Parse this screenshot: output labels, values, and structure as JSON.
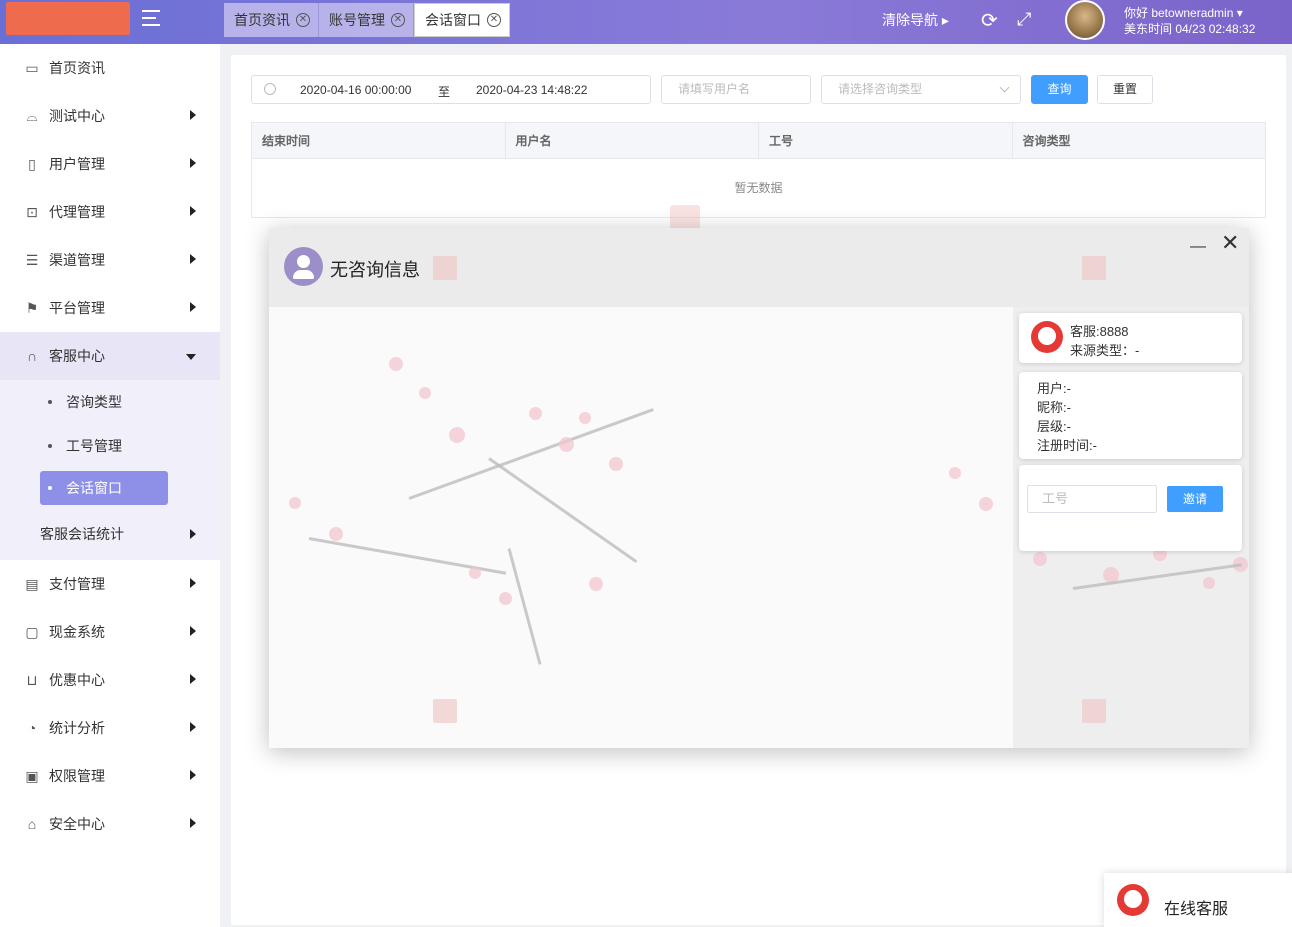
{
  "header": {
    "tabs": [
      {
        "label": "首页资讯"
      },
      {
        "label": "账号管理"
      },
      {
        "label": "会话窗口"
      }
    ],
    "clear_nav": "清除导航 ▸",
    "refresh_icon": "refresh-icon",
    "fullscreen_icon": "fullscreen-icon",
    "greeting": "你好 betowneradmin ▾",
    "time": "美东时间 04/23 02:48:32"
  },
  "sidebar": {
    "items": [
      {
        "label": "首页资讯",
        "icon": "monitor-icon"
      },
      {
        "label": "测试中心",
        "icon": "test-icon"
      },
      {
        "label": "用户管理",
        "icon": "user-icon"
      },
      {
        "label": "代理管理",
        "icon": "briefcase-icon"
      },
      {
        "label": "渠道管理",
        "icon": "document-icon"
      },
      {
        "label": "平台管理",
        "icon": "flag-icon"
      },
      {
        "label": "客服中心",
        "icon": "headset-icon"
      }
    ],
    "sub_items": [
      {
        "label": "咨询类型"
      },
      {
        "label": "工号管理"
      },
      {
        "label": "会话窗口"
      }
    ],
    "stat_item": {
      "label": "客服会话统计"
    },
    "items_after": [
      {
        "label": "支付管理",
        "icon": "card-icon"
      },
      {
        "label": "现金系统",
        "icon": "folder-icon"
      },
      {
        "label": "优惠中心",
        "icon": "cart-icon"
      },
      {
        "label": "统计分析",
        "icon": "pie-icon"
      },
      {
        "label": "权限管理",
        "icon": "book-icon"
      },
      {
        "label": "安全中心",
        "icon": "lock-icon"
      }
    ]
  },
  "filters": {
    "start_date": "2020-04-16 00:00:00",
    "to_label": "至",
    "end_date": "2020-04-23 14:48:22",
    "username_placeholder": "请填写用户名",
    "consult_type_placeholder": "请选择咨询类型",
    "search_label": "查询",
    "reset_label": "重置"
  },
  "table": {
    "columns": [
      "结束时间",
      "用户名",
      "工号",
      "咨询类型"
    ],
    "empty_text": "暂无数据"
  },
  "dialog": {
    "title": "无咨询信息",
    "minimize": "—",
    "close": "✕",
    "agent_line": "客服:8888",
    "source_line": "来源类型：-",
    "user_line": "用户:-",
    "nickname_line": "昵称:-",
    "level_line": "层级:-",
    "register_line": "注册时间:-",
    "worknum_placeholder": "工号",
    "invite_label": "邀请"
  },
  "online_service": {
    "label": "在线客服"
  },
  "colors": {
    "header_gradient_start": "#6a6fd6",
    "accent": "#409eff",
    "active_menu": "#8e8fe6"
  }
}
